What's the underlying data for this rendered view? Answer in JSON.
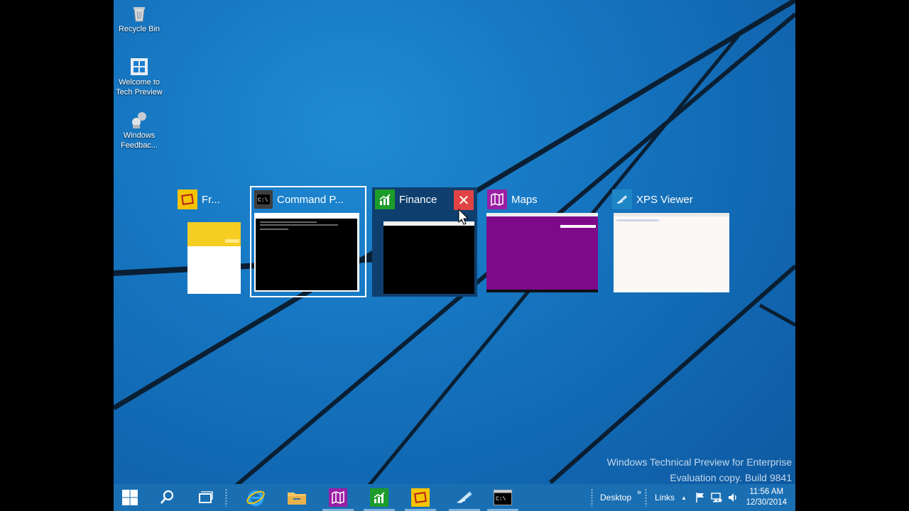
{
  "desktop": {
    "icons": [
      {
        "label_lines": [
          "Recycle Bin"
        ],
        "icon": "recycle-bin-icon"
      },
      {
        "label_lines": [
          "Welcome to",
          "Tech Preview"
        ],
        "icon": "windows-logo-icon"
      },
      {
        "label_lines": [
          "Windows",
          "Feedbac..."
        ],
        "icon": "feedback-icon"
      }
    ],
    "watermark": {
      "line1": "Windows Technical Preview for Enterprise",
      "line2": "Evaluation copy. Build 9841"
    }
  },
  "task_view": {
    "windows": [
      {
        "title": "Fr...",
        "app_icon": "fresh-paint-icon",
        "accent": "#f5c400",
        "selected": false,
        "hovered": false
      },
      {
        "title": "Command P...",
        "app_icon": "command-prompt-icon",
        "accent": "#000000",
        "selected": true,
        "hovered": false
      },
      {
        "title": "Finance",
        "app_icon": "finance-icon",
        "accent": "#1c9c2a",
        "selected": false,
        "hovered": true
      },
      {
        "title": "Maps",
        "app_icon": "maps-icon",
        "accent": "#9b1fa5",
        "selected": false,
        "hovered": false
      },
      {
        "title": "XPS Viewer",
        "app_icon": "xps-viewer-icon",
        "accent": "#1f86c6",
        "selected": false,
        "hovered": false
      }
    ],
    "close_label": "✕"
  },
  "taskbar": {
    "buttons": [
      {
        "name": "start-button",
        "icon": "windows-logo-icon"
      },
      {
        "name": "search-button",
        "icon": "search-icon"
      },
      {
        "name": "task-view-button",
        "icon": "task-view-icon"
      },
      {
        "name": "internet-explorer-button",
        "icon": "internet-explorer-icon"
      },
      {
        "name": "file-explorer-button",
        "icon": "folder-icon"
      },
      {
        "name": "maps-taskbar-button",
        "icon": "maps-icon"
      },
      {
        "name": "finance-taskbar-button",
        "icon": "finance-icon"
      },
      {
        "name": "fresh-paint-taskbar-button",
        "icon": "fresh-paint-icon"
      },
      {
        "name": "xps-viewer-taskbar-button",
        "icon": "xps-viewer-icon"
      },
      {
        "name": "command-prompt-taskbar-button",
        "icon": "command-prompt-icon"
      }
    ],
    "toolbar_desktop": "Desktop",
    "toolbar_links": "Links",
    "toolbar_chevron": "»",
    "tray_up": "▲",
    "clock": {
      "time": "11:56 AM",
      "date": "12/30/2014"
    },
    "accent": "#1a6fb3"
  }
}
